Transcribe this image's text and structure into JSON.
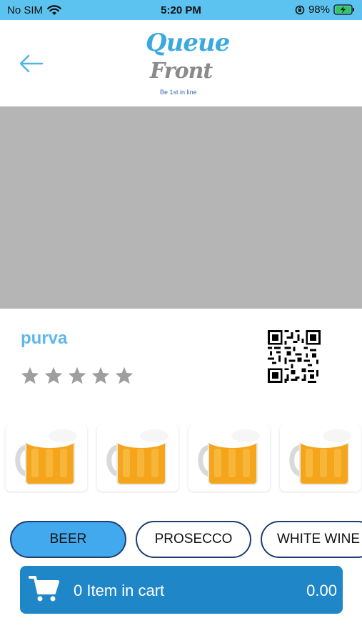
{
  "status_bar": {
    "carrier": "No SIM",
    "time": "5:20 PM",
    "battery": "98%",
    "icons": [
      "wifi-icon",
      "orientation-lock-icon",
      "battery-charging-icon"
    ]
  },
  "header": {
    "back_icon": "arrow-left-icon",
    "logo": {
      "line1": "Queue",
      "line2": "Front",
      "tagline": "Be 1st in line"
    }
  },
  "venue": {
    "name": "purva",
    "rating": {
      "value": 0,
      "max": 5
    },
    "qr_icon": "qr-code-icon"
  },
  "products": [
    {
      "image": "beer-mug-image"
    },
    {
      "image": "beer-mug-image"
    },
    {
      "image": "beer-mug-image"
    },
    {
      "image": "beer-mug-image"
    }
  ],
  "categories": [
    {
      "label": "BEER",
      "active": true
    },
    {
      "label": "PROSECCO",
      "active": false
    },
    {
      "label": "WHITE WINE",
      "active": false
    }
  ],
  "cart": {
    "icon": "cart-icon",
    "label": "0 Item in cart",
    "total": "0.00"
  },
  "colors": {
    "status_bar": "#5cc2ef",
    "accent": "#42a9ef",
    "venue_name": "#5cb8ea",
    "cart_bar": "#1f86c8",
    "banner": "#b5b5b5",
    "star": "#9e9e9e"
  }
}
